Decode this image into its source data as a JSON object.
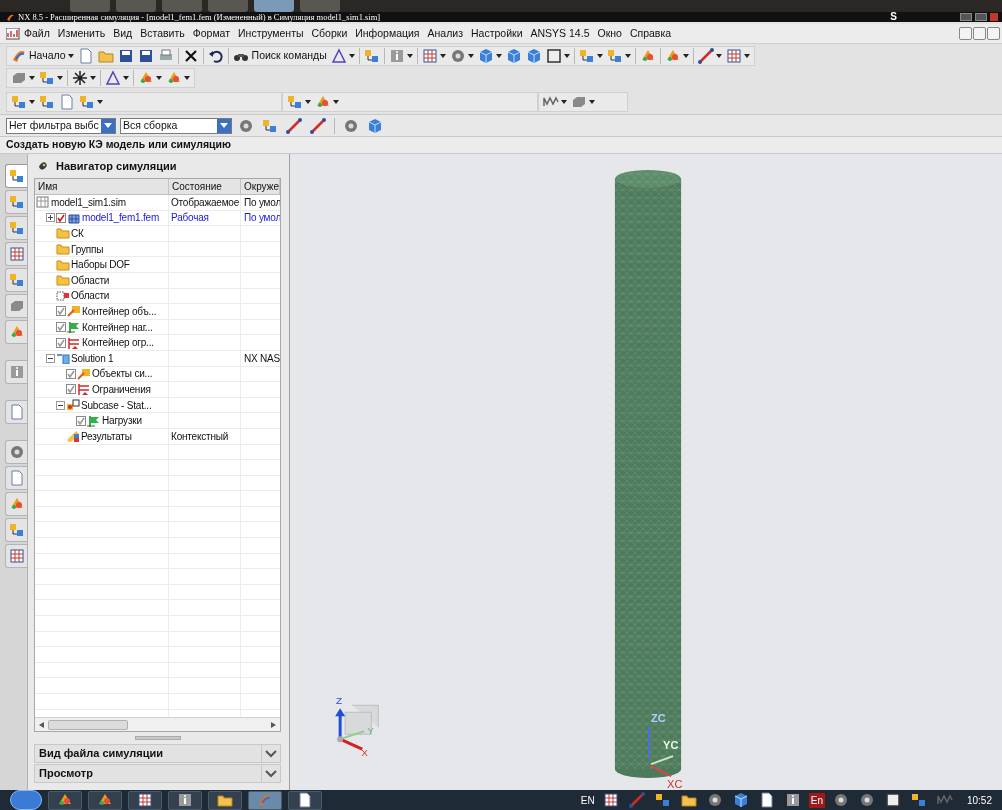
{
  "window": {
    "title": "NX 8.5 - Расширенная симуляция - [model1_fem1.fem (Измененный)  в Симуляция model1_sim1.sim]",
    "overlay_letter": "S"
  },
  "menu": [
    "Файл",
    "Изменить",
    "Вид",
    "Вставить",
    "Формат",
    "Инструменты",
    "Сборки",
    "Информация",
    "Анализ",
    "Настройки",
    "ANSYS 14.5",
    "Окно",
    "Справка"
  ],
  "toolbar": {
    "start_button": "Начало",
    "command_search": "Поиск команды"
  },
  "filters": [
    {
      "value": "Нет фильтра выбс"
    },
    {
      "value": "Вся сборка"
    }
  ],
  "cue_line": "Создать новую КЭ модель или симуляцию",
  "resource_tabs": [
    {
      "selected": true
    },
    {
      "selected": false
    },
    {
      "selected": false
    },
    {
      "selected": false
    },
    {
      "selected": false
    },
    {
      "selected": false
    },
    {
      "selected": false
    },
    {
      "selected": false
    },
    {
      "selected": false
    },
    {
      "selected": false
    },
    {
      "selected": false
    },
    {
      "selected": false
    },
    {
      "selected": false
    },
    {
      "selected": false
    }
  ],
  "navigator": {
    "title": "Навигатор симуляции",
    "columns": [
      "Имя",
      "Состояние",
      "Окруже"
    ],
    "rows": [
      {
        "name": "model1_sim1.sim",
        "state": "Отображаемое",
        "environment": "По умол",
        "kind": "sim",
        "children": [
          {
            "name": "model1_fem1.fem",
            "state": "Рабочая",
            "environment": "По умол",
            "kind": "fem",
            "checked": true,
            "current": true,
            "expanded": false
          },
          {
            "name": "СК",
            "kind": "folder"
          },
          {
            "name": "Группы",
            "kind": "folder"
          },
          {
            "name": "Наборы DOF",
            "kind": "folder"
          },
          {
            "name": "Области",
            "kind": "folder"
          },
          {
            "name": "Области",
            "kind": "region"
          },
          {
            "name": "Контейнер объ...",
            "kind": "object",
            "checked": true,
            "current": false
          },
          {
            "name": "Контейнер наг...",
            "kind": "load",
            "checked": true,
            "current": false
          },
          {
            "name": "Контейнер огр...",
            "kind": "constraint",
            "checked": true,
            "current": false
          },
          {
            "name": "Solution 1",
            "environment": "NX NAS",
            "kind": "solution",
            "expanded": true,
            "children": [
              {
                "name": "Объекты си...",
                "kind": "object",
                "checked": true,
                "current": false
              },
              {
                "name": "Ограничения",
                "kind": "constraint",
                "checked": true,
                "current": false
              },
              {
                "name": "Subcase - Stat...",
                "kind": "subcase",
                "expanded": true,
                "children": [
                  {
                    "name": "Нагрузки",
                    "kind": "load",
                    "checked": true,
                    "current": false
                  }
                ]
              },
              {
                "name": "Результаты",
                "state": "Контекстный",
                "kind": "results"
              }
            ]
          }
        ]
      }
    ],
    "sections": [
      {
        "title": "Вид файла симуляции",
        "expanded": false
      },
      {
        "title": "Просмотр",
        "expanded": false
      }
    ]
  },
  "viewport": {
    "wcs_labels": [
      "Z",
      "Y",
      "X"
    ],
    "csys_labels": [
      "ZC",
      "YC",
      "XC"
    ]
  },
  "taskbar": {
    "language": "EN",
    "tray_label": "En",
    "clock": "10:52"
  }
}
